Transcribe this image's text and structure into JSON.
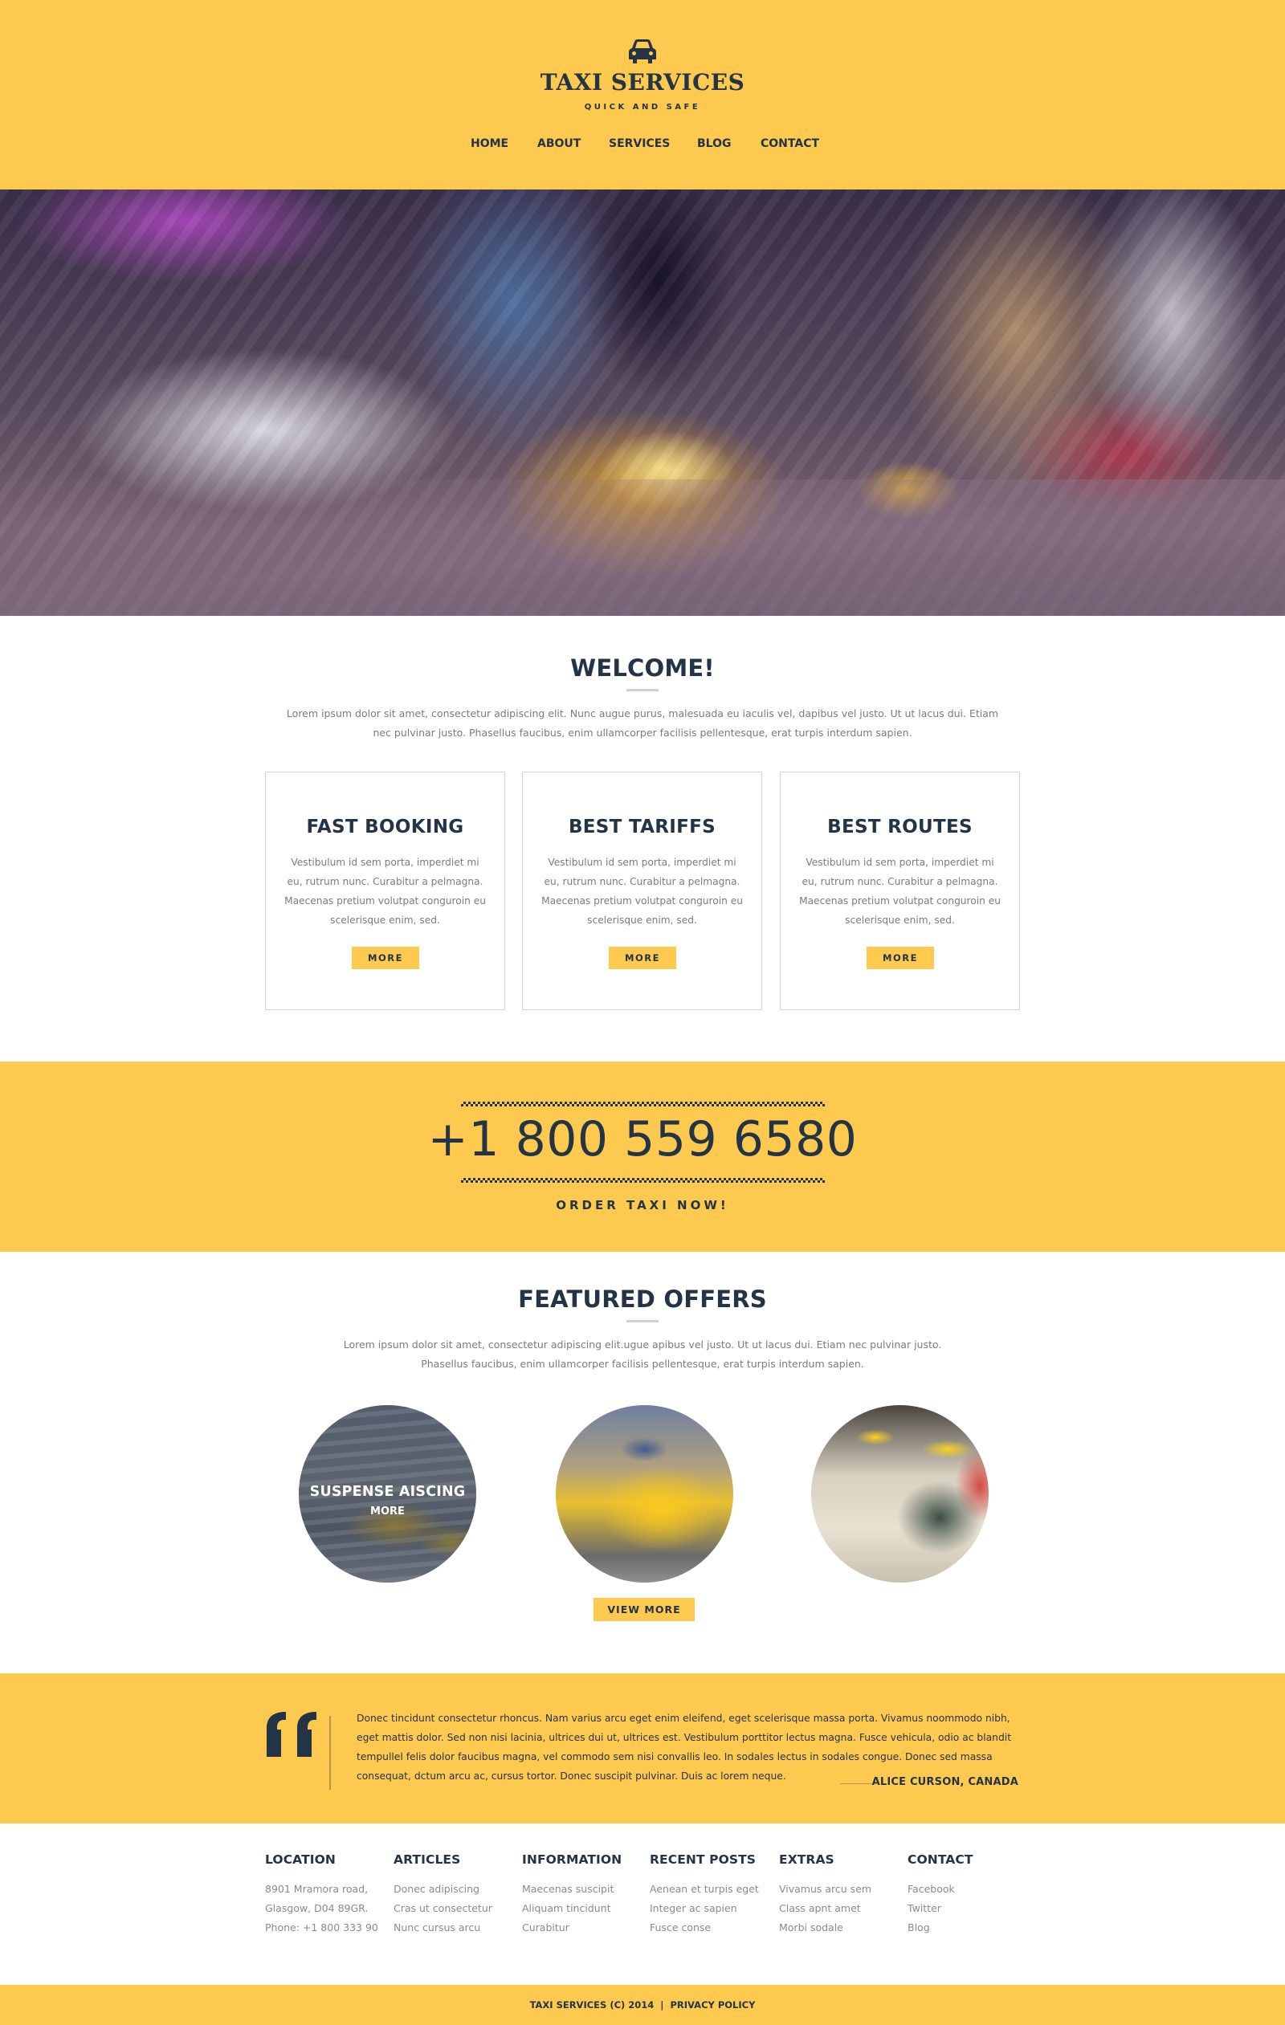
{
  "colors": {
    "brand_yellow": "#fec94f",
    "navy": "#233446",
    "muted_text": "#7b7b7b",
    "card_border": "#d6d6d6"
  },
  "header": {
    "logo_icon": "taxi-car-icon",
    "title": "TAXI SERVICES",
    "tagline": "QUICK AND SAFE",
    "nav": [
      {
        "label": "HOME"
      },
      {
        "label": "ABOUT"
      },
      {
        "label": "SERVICES"
      },
      {
        "label": "BLOG"
      },
      {
        "label": "CONTACT"
      }
    ]
  },
  "hero": {
    "image_description": "Blurred night city street with yellow taxis"
  },
  "welcome": {
    "title": "WELCOME!",
    "intro": "Lorem ipsum dolor sit amet, consectetur adipiscing elit. Nunc augue purus, malesuada eu iaculis vel, dapibus vel justo. Ut ut lacus dui. Etiam nec pulvinar justo. Phasellus faucibus, enim ullamcorper facilisis pellentesque, erat turpis interdum sapien.",
    "cards": [
      {
        "title": "FAST BOOKING",
        "text": "Vestibulum id sem porta, imperdiet mi eu, rutrum nunc. Curabitur a pelmagna. Maecenas pretium volutpat conguroin eu scelerisque enim, sed.",
        "button": "MORE"
      },
      {
        "title": "BEST TARIFFS",
        "text": "Vestibulum id sem porta, imperdiet mi eu, rutrum nunc. Curabitur a pelmagna. Maecenas pretium volutpat conguroin eu scelerisque enim, sed.",
        "button": "MORE"
      },
      {
        "title": "BEST ROUTES",
        "text": "Vestibulum id sem porta, imperdiet mi eu, rutrum nunc. Curabitur a pelmagna. Maecenas pretium volutpat conguroin eu scelerisque enim, sed.",
        "button": "MORE"
      }
    ]
  },
  "order": {
    "phone": "+1 800 559 6580",
    "cta": "ORDER TAXI NOW!"
  },
  "featured": {
    "title": "FEATURED OFFERS",
    "intro": "Lorem ipsum dolor sit amet, consectetur adipiscing elit.ugue apibus vel justo. Ut ut lacus dui. Etiam nec pulvinar justo. Phasellus faucibus, enim ullamcorper facilisis pellentesque, erat turpis interdum sapien.",
    "offers": [
      {
        "caption": "SUSPENSE AISCING",
        "more": "MORE",
        "image": "taxis crossing snowy street"
      },
      {
        "image": "yellow cab with open door in rain"
      },
      {
        "image": "taxi roof signs close-up"
      }
    ],
    "view_more": "VIEW MORE"
  },
  "testimonial": {
    "quote_icon": "quote-icon",
    "text": "Donec tincidunt consectetur rhoncus. Nam varius arcu eget enim eleifend, eget scelerisque massa porta. Vivamus noommodo nibh, eget mattis dolor. Sed non nisi lacinia, ultrices dui ut, ultrices est. Vestibulum porttitor lectus magna. Fusce vehicula, odio ac blandit tempullel felis dolor faucibus magna, vel commodo sem nisi convallis leo. In sodales lectus in sodales congue. Donec sed massa consequat, dctum arcu ac, cursus tortor. Donec suscipit pulvinar. Duis ac lorem neque.",
    "author": "ALICE CURSON, CANADA"
  },
  "footer": {
    "columns": [
      {
        "title": "LOCATION",
        "items": [
          "8901 Mramora road,",
          "Glasgow, D04 89GR.",
          "Phone: +1 800 333 90"
        ]
      },
      {
        "title": "ARTICLES",
        "items": [
          "Donec adipiscing",
          "Cras ut consectetur",
          "Nunc cursus arcu"
        ]
      },
      {
        "title": "INFORMATION",
        "items": [
          "Maecenas suscipit",
          "Aliquam tincidunt",
          "Curabitur"
        ]
      },
      {
        "title": "RECENT POSTS",
        "items": [
          "Aenean et turpis eget",
          "Integer ac sapien",
          "Fusce conse"
        ]
      },
      {
        "title": "EXTRAS",
        "items": [
          "Vivamus arcu sem",
          "Class apnt amet",
          "Morbi sodale"
        ]
      },
      {
        "title": "CONTACT",
        "items": [
          "Facebook",
          "Twitter",
          "Blog"
        ]
      }
    ],
    "copyright": "TAXI SERVICES (C) 2014",
    "separator": "|",
    "privacy": "PRIVACY POLICY"
  }
}
